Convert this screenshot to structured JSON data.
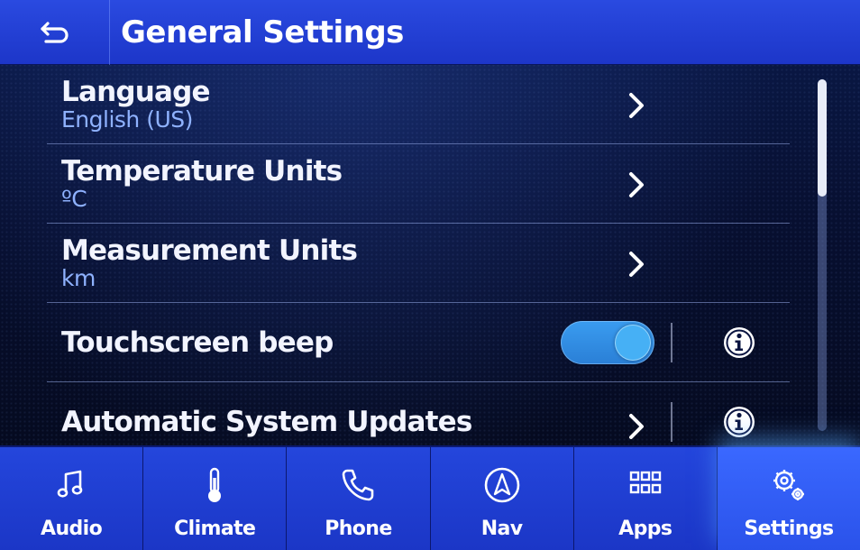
{
  "header": {
    "title": "General Settings",
    "back_icon": "back-arrow-icon"
  },
  "settings": {
    "items": [
      {
        "label": "Language",
        "value": "English (US)",
        "control": "chevron"
      },
      {
        "label": "Temperature Units",
        "value": "ºC",
        "control": "chevron"
      },
      {
        "label": "Measurement Units",
        "value": "km",
        "control": "chevron"
      },
      {
        "label": "Touchscreen beep",
        "control": "toggle",
        "toggle_on": true,
        "info": true
      },
      {
        "label": "Automatic System Updates",
        "control": "chevron",
        "info": true
      }
    ]
  },
  "nav": {
    "items": [
      {
        "label": "Audio",
        "icon": "music-note-icon",
        "active": false
      },
      {
        "label": "Climate",
        "icon": "thermometer-icon",
        "active": false
      },
      {
        "label": "Phone",
        "icon": "phone-icon",
        "active": false
      },
      {
        "label": "Nav",
        "icon": "navigation-icon",
        "active": false
      },
      {
        "label": "Apps",
        "icon": "apps-grid-icon",
        "active": false
      },
      {
        "label": "Settings",
        "icon": "gears-icon",
        "active": true
      }
    ]
  },
  "colors": {
    "header_bg": "#1d36c9",
    "accent_blue": "#3a9cf0",
    "value_text": "#8fb2ff",
    "nav_active": "#3a68ff"
  }
}
